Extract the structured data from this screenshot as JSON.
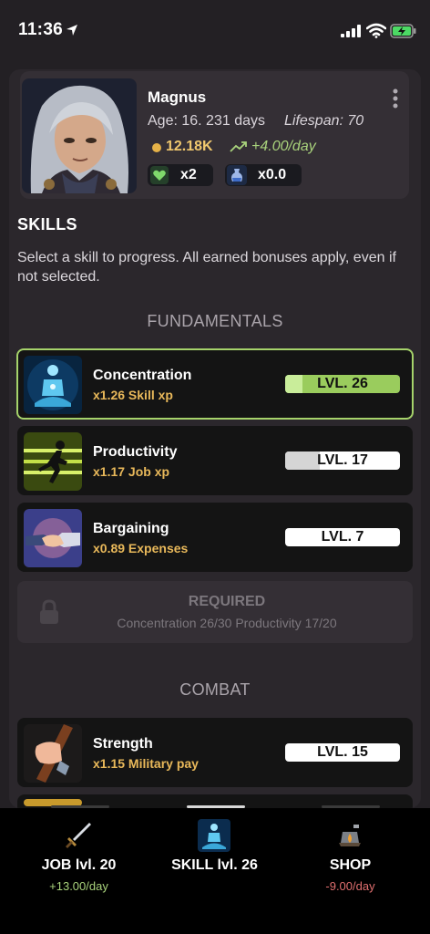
{
  "status_bar": {
    "time": "11:36"
  },
  "profile": {
    "name": "Magnus",
    "age": "Age: 16. 231 days",
    "lifespan": "Lifespan: 70",
    "money": "12.18K",
    "income": "+4.00/day",
    "heart_multiplier": "x2",
    "potion_multiplier": "x0.0"
  },
  "skills_section": {
    "title": "SKILLS",
    "description": "Select a skill to progress. All earned bonuses apply, even if not selected."
  },
  "categories": {
    "fundamentals": "FUNDAMENTALS",
    "combat": "COMBAT"
  },
  "skills": [
    {
      "name": "Concentration",
      "bonus": "x1.26 Skill xp",
      "level": "LVL. 26",
      "progress": 0.15,
      "selected": true
    },
    {
      "name": "Productivity",
      "bonus": "x1.17 Job xp",
      "level": "LVL. 17",
      "progress": 0.3,
      "selected": false
    },
    {
      "name": "Bargaining",
      "bonus": "x0.89 Expenses",
      "level": "LVL. 7",
      "progress": 0.0,
      "selected": false
    },
    {
      "name": "Strength",
      "bonus": "x1.15 Military pay",
      "level": "LVL. 15",
      "progress": 0.0,
      "selected": false
    }
  ],
  "locked": {
    "title": "REQUIRED",
    "requirement": "Concentration 26/30 Productivity 17/20"
  },
  "nav": [
    {
      "label": "JOB lvl. 20",
      "sub": "+13.00/day",
      "icon": "sword-icon"
    },
    {
      "label": "SKILL lvl. 26",
      "sub": "",
      "icon": "skill-meditation-icon"
    },
    {
      "label": "SHOP",
      "sub": "-9.00/day",
      "icon": "shop-campfire-icon"
    }
  ],
  "colors": {
    "accent_green": "#a6d36b",
    "gold": "#e8b85a",
    "negative": "#e06f6f",
    "background": "#232024"
  }
}
